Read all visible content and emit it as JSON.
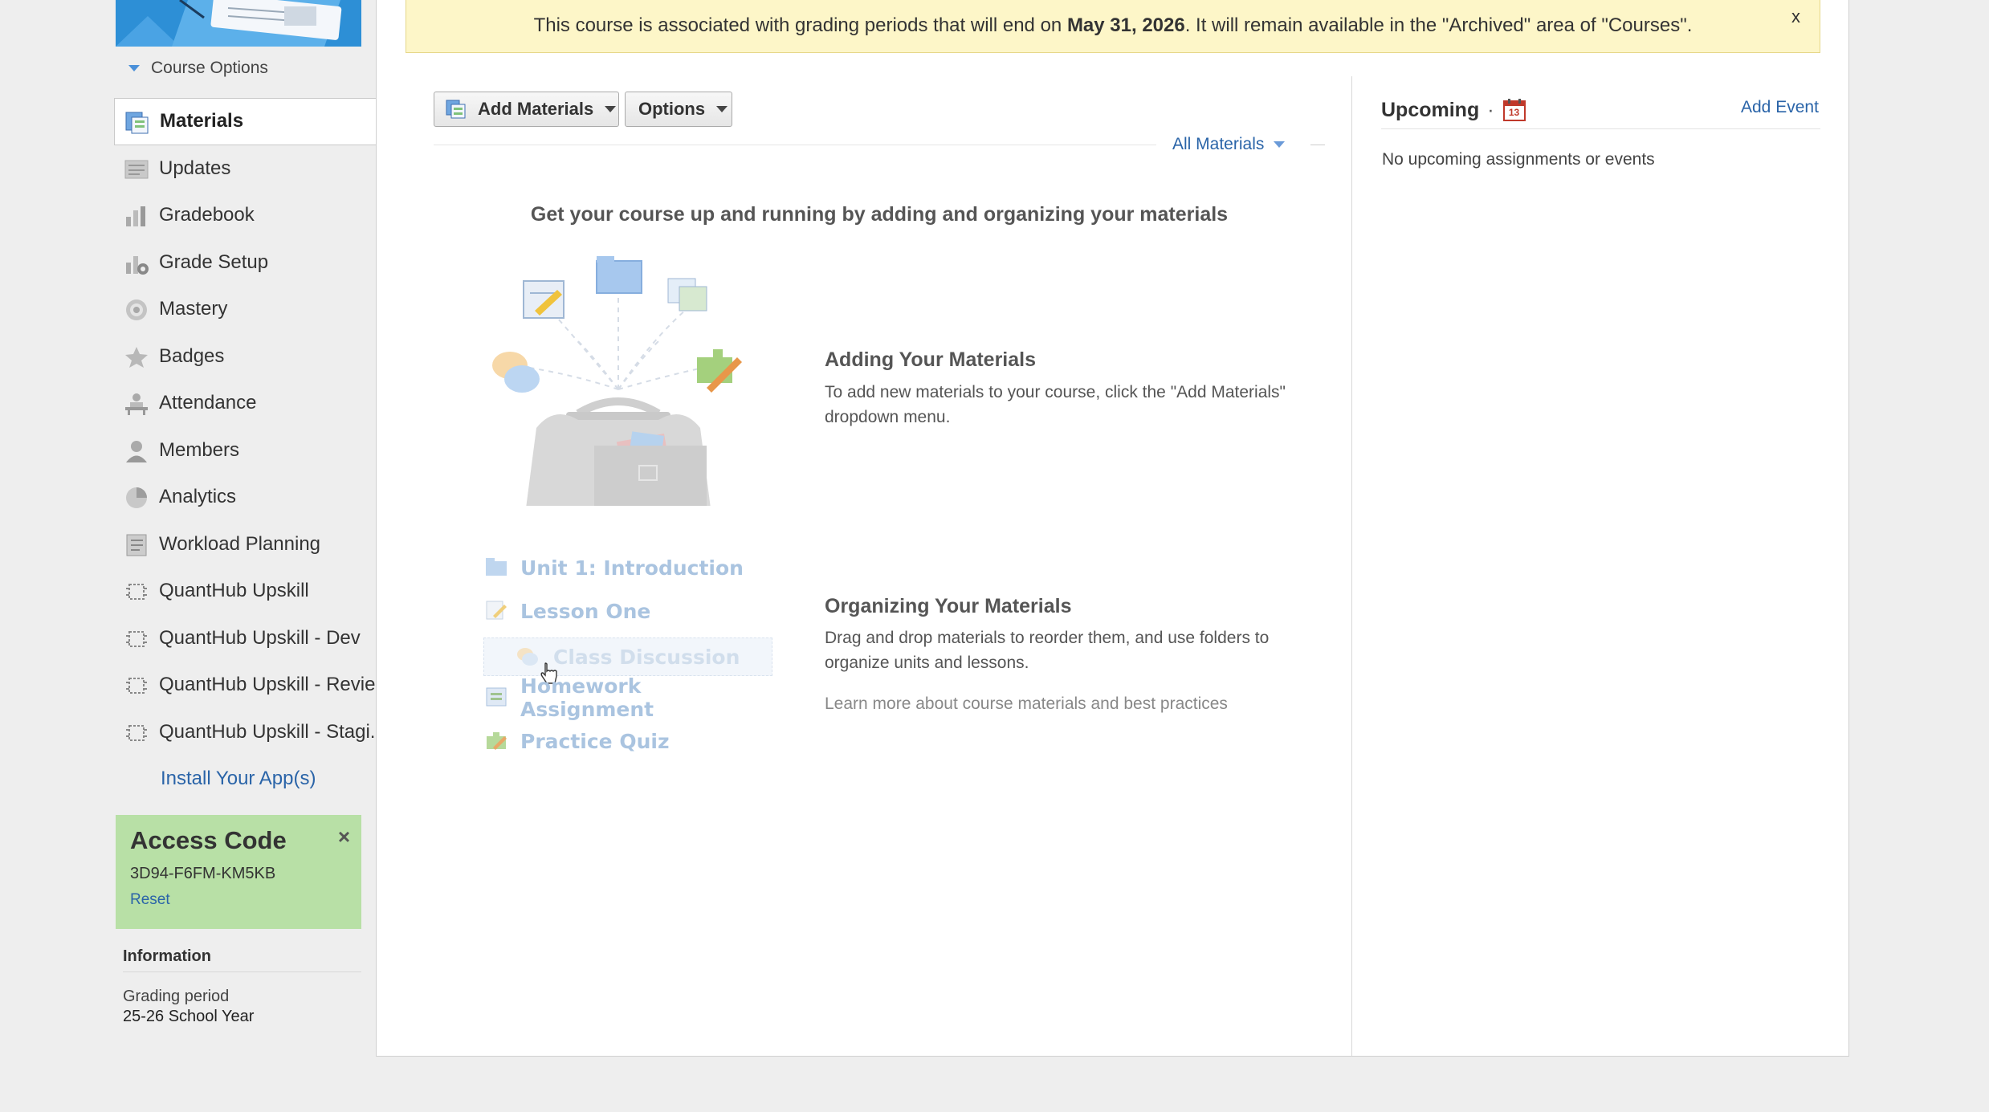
{
  "banner": {
    "text_before": "This course is associated with grading periods that will end on ",
    "date": "May 31, 2026",
    "text_after": ". It will remain available in the \"Archived\" area of \"Courses\".",
    "close_label": "x"
  },
  "sidebar": {
    "course_options_label": "Course Options",
    "items": [
      {
        "label": "Materials",
        "icon": "materials-icon"
      },
      {
        "label": "Updates",
        "icon": "updates-icon"
      },
      {
        "label": "Gradebook",
        "icon": "gradebook-icon"
      },
      {
        "label": "Grade Setup",
        "icon": "grade-setup-icon"
      },
      {
        "label": "Mastery",
        "icon": "mastery-icon"
      },
      {
        "label": "Badges",
        "icon": "badges-icon"
      },
      {
        "label": "Attendance",
        "icon": "attendance-icon"
      },
      {
        "label": "Members",
        "icon": "members-icon"
      },
      {
        "label": "Analytics",
        "icon": "analytics-icon"
      },
      {
        "label": "Workload Planning",
        "icon": "workload-planning-icon"
      },
      {
        "label": "QuantHub Upskill",
        "icon": "app-chip-icon"
      },
      {
        "label": "QuantHub Upskill - Dev",
        "icon": "app-chip-icon"
      },
      {
        "label": "QuantHub Upskill - Revie...",
        "icon": "app-chip-icon"
      },
      {
        "label": "QuantHub Upskill - Stagi...",
        "icon": "app-chip-icon"
      }
    ],
    "install_label": "Install Your App(s)",
    "access_code": {
      "title": "Access Code",
      "code": "3D94-F6FM-KM5KB",
      "reset_label": "Reset",
      "close_label": "×"
    },
    "information": {
      "title": "Information",
      "grading_period_label": "Grading period",
      "grading_period_value": "25-26 School Year"
    }
  },
  "toolbar": {
    "add_materials_label": "Add Materials",
    "options_label": "Options",
    "filter_label": "All Materials"
  },
  "main": {
    "headline": "Get your course up and running by adding and organizing your materials",
    "adding_title": "Adding Your Materials",
    "adding_body": "To add new materials to your course, click the \"Add Materials\" dropdown menu.",
    "organizing_title": "Organizing Your Materials",
    "organizing_body": "Drag and drop materials to reorder them, and use folders to organize units and lessons.",
    "learn_more": "Learn more about course materials and best practices",
    "sample_items": [
      {
        "label": "Unit 1: Introduction",
        "icon": "folder-icon"
      },
      {
        "label": "Lesson One",
        "icon": "page-icon"
      },
      {
        "label": "Class Discussion",
        "icon": "discussion-icon"
      },
      {
        "label": "Homework Assignment",
        "icon": "assignment-icon"
      },
      {
        "label": "Practice Quiz",
        "icon": "quiz-icon"
      }
    ]
  },
  "upcoming": {
    "title": "Upcoming",
    "separator": "·",
    "calendar_day": "13",
    "add_event_label": "Add Event",
    "empty_text": "No upcoming assignments or events"
  },
  "colors": {
    "link": "#2a64a8",
    "banner_bg": "#fdf6c8",
    "access_code_bg": "#b8e0a6",
    "course_image_blue": "#2d8fd6"
  }
}
